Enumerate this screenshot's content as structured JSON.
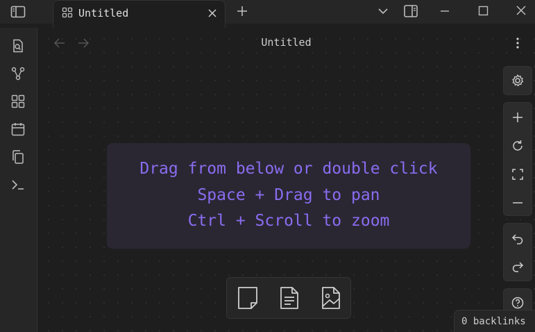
{
  "tab": {
    "title": "Untitled"
  },
  "view": {
    "title": "Untitled"
  },
  "hints": [
    "Drag from below or double click",
    "Space + Drag to pan",
    "Ctrl + Scroll to zoom"
  ],
  "status": {
    "backlinks": "0 backlinks"
  },
  "colors": {
    "hint_text": "#8b6cf0",
    "hint_bg": "#2a2733",
    "background": "#1e1e1e",
    "chrome": "#262626"
  },
  "icons": {
    "ribbon": [
      "file-search-icon",
      "graph-icon",
      "dashboard-icon",
      "calendar-icon",
      "copy-icon",
      "terminal-icon"
    ],
    "controls": [
      "settings-icon",
      "zoom-in-icon",
      "reset-zoom-icon",
      "fit-icon",
      "zoom-out-icon",
      "undo-icon",
      "redo-icon",
      "help-icon"
    ],
    "cards": [
      "new-card-icon",
      "note-card-icon",
      "media-card-icon"
    ]
  }
}
